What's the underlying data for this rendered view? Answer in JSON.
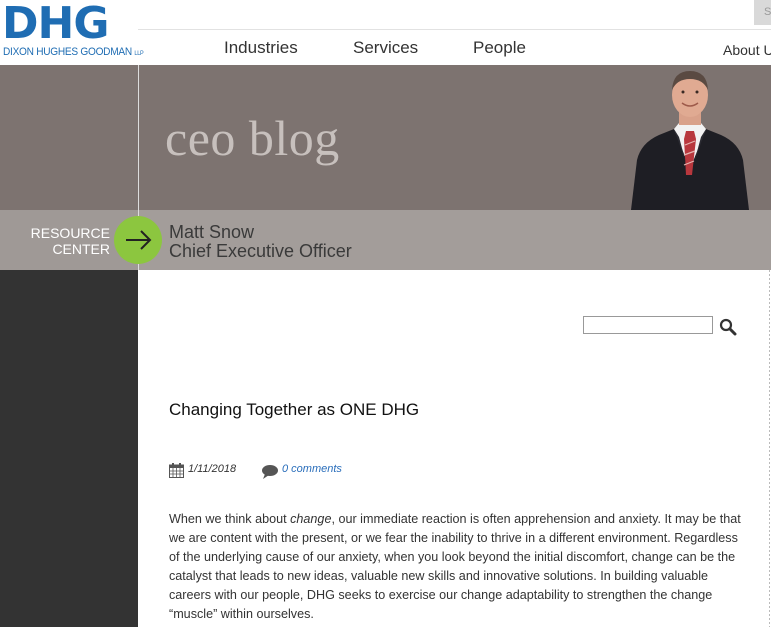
{
  "brand": {
    "logo_mark": "DHG",
    "logo_sub": "DIXON HUGHES GOODMAN",
    "logo_llp": "LLP"
  },
  "header": {
    "search_stub": "S",
    "nav": [
      "Industries",
      "Services",
      "People"
    ],
    "about": "About U"
  },
  "banner": {
    "title": "ceo blog",
    "resource_center_line1": "RESOURCE",
    "resource_center_line2": "CENTER",
    "author_name": "Matt Snow",
    "author_role": "Chief Executive Officer"
  },
  "search": {
    "placeholder": ""
  },
  "post": {
    "title": "Changing Together as ONE DHG",
    "date": "1/11/2018",
    "comments": "0 comments",
    "body_pre": "When we think about ",
    "body_em": "change",
    "body_post": ", our immediate reaction is often apprehension and anxiety. It may be that we are content with the present, or we fear the inability to thrive in a different environment. Regardless of the underlying cause of our anxiety, when you look beyond the initial discomfort, change can be the catalyst that leads to new ideas, valuable new skills and innovative solutions. In building valuable careers with our people, DHG seeks to exercise our change adaptability to strengthen the change “muscle” within ourselves."
  },
  "colors": {
    "brand_blue": "#1f6db3",
    "banner_bg": "#7d7370",
    "strip_bg": "#a39d9a",
    "accent_green": "#8cc63f",
    "sidebar_dark": "#333333",
    "link_blue": "#2a6ebb"
  },
  "icons": [
    "arrow-right-icon",
    "search-icon",
    "calendar-icon",
    "comment-icon"
  ]
}
